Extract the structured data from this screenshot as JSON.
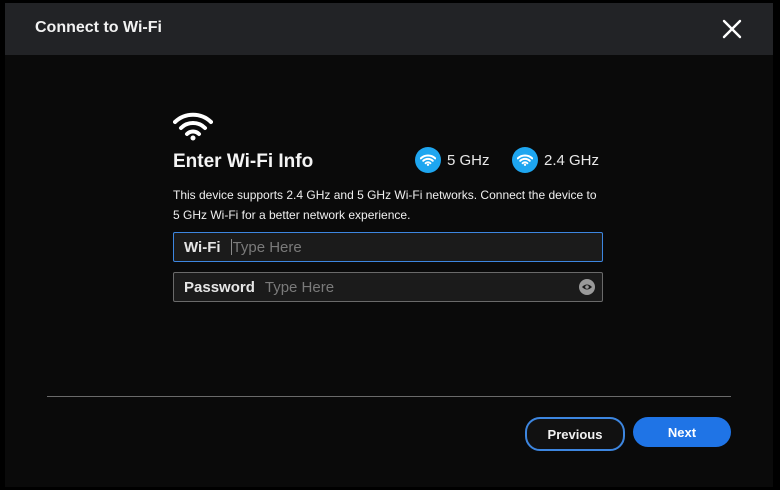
{
  "dialog": {
    "title": "Connect to Wi-Fi",
    "close_icon": "close-icon"
  },
  "content": {
    "main_icon": "wifi-icon",
    "heading": "Enter Wi-Fi Info",
    "bands": [
      {
        "label": "5 GHz",
        "icon": "wifi-icon",
        "color": "#1ea6f0"
      },
      {
        "label": "2.4 GHz",
        "icon": "wifi-icon",
        "color": "#1ea6f0"
      }
    ],
    "description": "This device supports 2.4 GHz and 5 GHz Wi-Fi networks. Connect the device to 5 GHz Wi-Fi for a better network experience."
  },
  "form": {
    "wifi": {
      "label": "Wi-Fi",
      "placeholder": "Type Here",
      "value": ""
    },
    "password": {
      "label": "Password",
      "placeholder": "Type Here",
      "value": "",
      "toggle_icon": "eye-icon"
    }
  },
  "footer": {
    "previous_label": "Previous",
    "next_label": "Next"
  },
  "colors": {
    "accent": "#1f74e6",
    "focus_border": "#3d86e0",
    "band_icon": "#1ea6f0"
  }
}
